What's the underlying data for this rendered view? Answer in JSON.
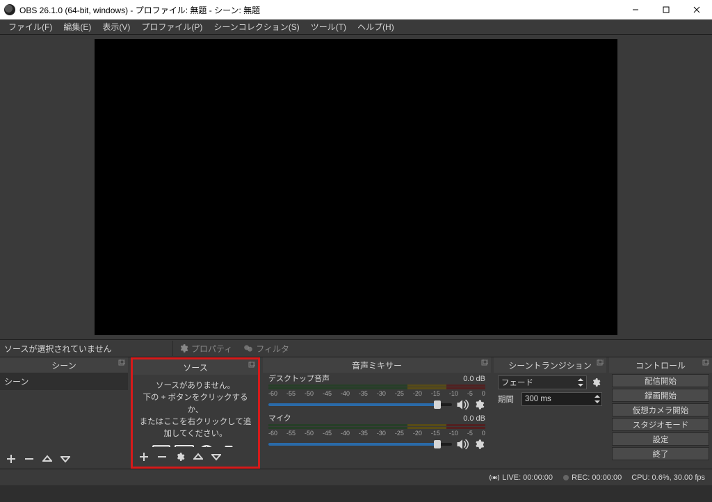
{
  "window": {
    "title": "OBS 26.1.0 (64-bit, windows) - プロファイル: 無題 - シーン: 無題"
  },
  "menu": {
    "file": "ファイル(F)",
    "edit": "編集(E)",
    "view": "表示(V)",
    "profile": "プロファイル(P)",
    "scene_collection": "シーンコレクション(S)",
    "tools": "ツール(T)",
    "help": "ヘルプ(H)"
  },
  "toolbar": {
    "no_selection": "ソースが選択されていません",
    "properties": "プロパティ",
    "filters": "フィルタ"
  },
  "scenes": {
    "title": "シーン",
    "items": [
      "シーン"
    ]
  },
  "sources": {
    "title": "ソース",
    "empty_line1": "ソースがありません。",
    "empty_line2": "下の + ボタンをクリックするか、",
    "empty_line3": "またはここを右クリックして追加してください。"
  },
  "mixer": {
    "title": "音声ミキサー",
    "channels": [
      {
        "name": "デスクトップ音声",
        "level": "0.0 dB"
      },
      {
        "name": "マイク",
        "level": "0.0 dB"
      }
    ],
    "scale": [
      "-60",
      "-55",
      "-50",
      "-45",
      "-40",
      "-35",
      "-30",
      "-25",
      "-20",
      "-15",
      "-10",
      "-5",
      "0"
    ]
  },
  "transitions": {
    "title": "シーントランジション",
    "selected": "フェード",
    "duration_label": "期間",
    "duration_value": "300 ms"
  },
  "controls": {
    "title": "コントロール",
    "buttons": [
      "配信開始",
      "録画開始",
      "仮想カメラ開始",
      "スタジオモード",
      "設定",
      "終了"
    ]
  },
  "status": {
    "live": "LIVE: 00:00:00",
    "rec": "REC: 00:00:00",
    "cpu": "CPU: 0.6%, 30.00 fps"
  }
}
